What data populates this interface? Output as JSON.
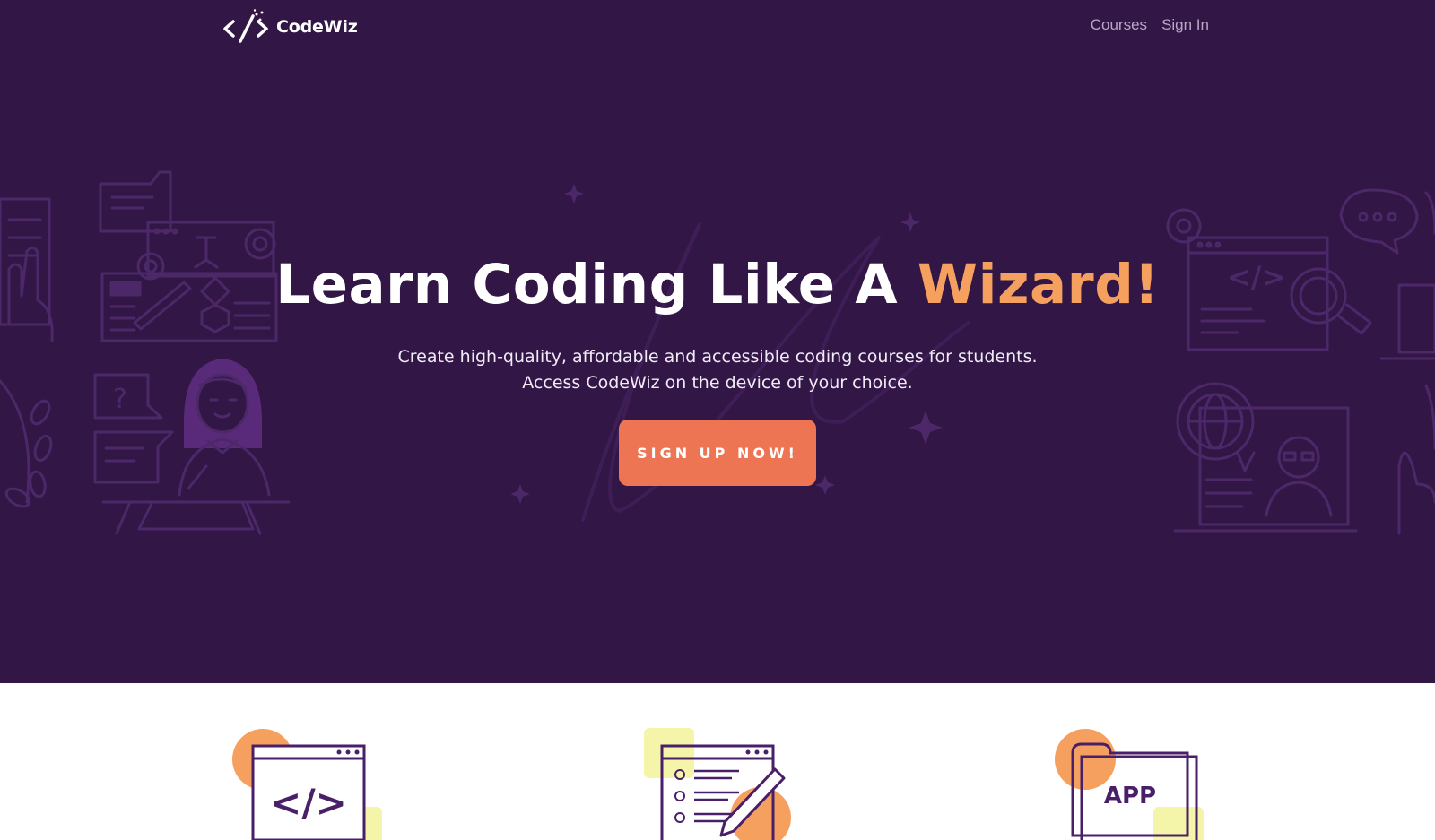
{
  "nav": {
    "brand": "CodeWiz",
    "links": [
      {
        "label": "Courses"
      },
      {
        "label": "Sign In"
      }
    ]
  },
  "hero": {
    "headline_main": "Learn Coding Like A ",
    "headline_accent": "Wizard!",
    "subtitle_line1": "Create high-quality, affordable and accessible coding courses for students.",
    "subtitle_line2": "Access CodeWiz on the device of your choice.",
    "cta_label": "SIGN UP NOW!"
  },
  "features": [
    {
      "icon": "code-window-icon",
      "code_glyph": "</>"
    },
    {
      "icon": "checklist-pencil-icon"
    },
    {
      "icon": "app-icon",
      "label": "APP"
    }
  ],
  "colors": {
    "hero_background": "#311646",
    "accent_orange": "#f5a05f",
    "cta_background": "#ee7554",
    "line_art": "#4d2868",
    "feature_circle": "#f5a05f",
    "feature_square": "#f4f5a8"
  }
}
